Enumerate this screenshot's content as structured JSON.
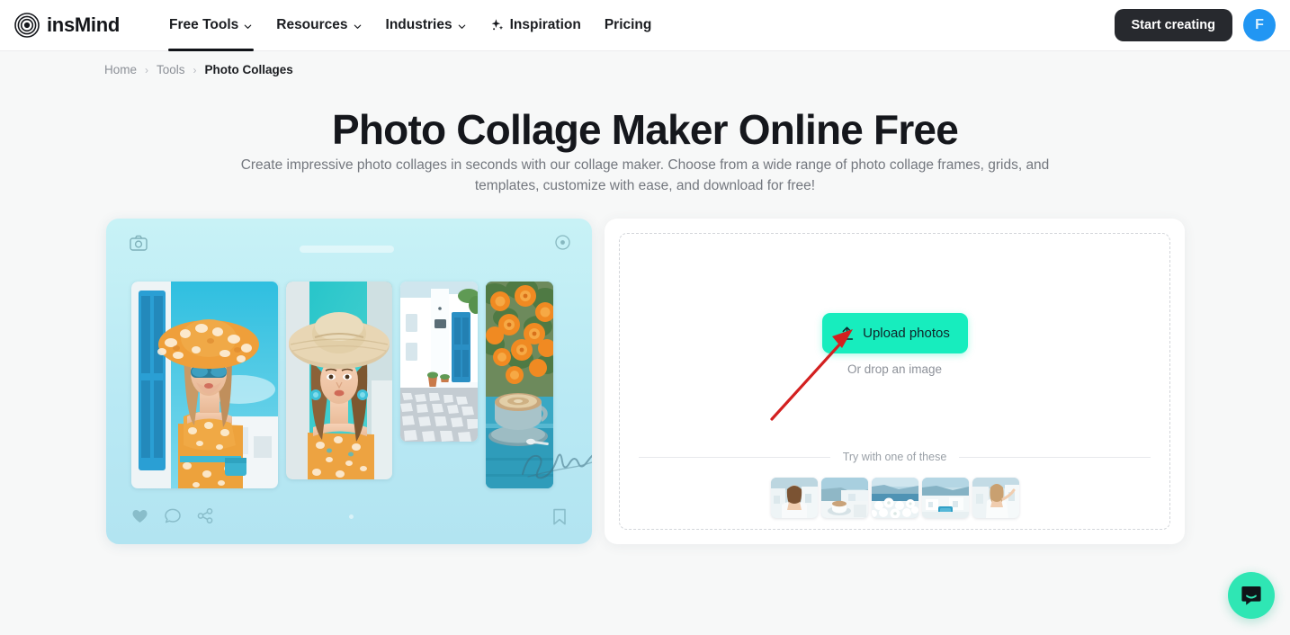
{
  "header": {
    "logo_text": "insMind",
    "logo_icon": "concentric-circles-logo",
    "nav": [
      {
        "label": "Free Tools",
        "has_caret": true,
        "active": true,
        "icon": "chevron-down-icon"
      },
      {
        "label": "Resources",
        "has_caret": true,
        "active": false,
        "icon": "chevron-down-icon"
      },
      {
        "label": "Industries",
        "has_caret": true,
        "active": false,
        "icon": "chevron-down-icon"
      },
      {
        "label": "Inspiration",
        "has_caret": false,
        "active": false,
        "icon": "sparkle-icon"
      },
      {
        "label": "Pricing",
        "has_caret": false,
        "active": false,
        "icon": ""
      }
    ],
    "start_creating_label": "Start creating",
    "avatar_initial": "F",
    "avatar_color": "#2196f3",
    "start_button_color": "#27292e"
  },
  "breadcrumb": {
    "home": "Home",
    "tools": "Tools",
    "current": "Photo Collages",
    "separator": "›"
  },
  "hero": {
    "title": "Photo Collage Maker Online Free",
    "subtitle": "Create impressive photo collages in seconds with our collage maker. Choose from a wide range of photo collage frames, grids, and templates, customize with ease, and download for free!"
  },
  "preview": {
    "card_bg": "#bce9f3",
    "camera_icon": "camera-icon",
    "circle_icon": "circle-plus-icon",
    "signature_text": "Santorini",
    "actions": [
      {
        "name": "heart-icon"
      },
      {
        "name": "comment-icon"
      },
      {
        "name": "share-icon"
      },
      {
        "name": "bookmark-icon"
      }
    ],
    "photos": [
      {
        "alt": "woman in orange floral dress with sun hat and sunglasses"
      },
      {
        "alt": "woman in wide brim straw hat with turquoise earrings"
      },
      {
        "alt": "white Santorini alley with blue door and cobblestones"
      },
      {
        "alt": "coffee cup with orange bougainvillea flowers"
      }
    ]
  },
  "upload": {
    "button_label": "Upload photos",
    "button_icon": "upload-arrow-icon",
    "button_color": "#17edbe",
    "drop_hint": "Or drop an image",
    "try_label": "Try with one of these",
    "dashed_border_color": "#d3d6da",
    "samples": [
      {
        "alt": "woman in white dress on Santorini terrace"
      },
      {
        "alt": "coffee cup overlooking Santorini caldera"
      },
      {
        "alt": "white flowers with blue sea view"
      },
      {
        "alt": "Santorini pool and white architecture"
      },
      {
        "alt": "woman in white dress against white wall"
      }
    ]
  },
  "annotation": {
    "arrow_color": "#d32020",
    "description": "red arrow pointing to upload photos button"
  },
  "chat": {
    "icon": "chat-bubble-icon",
    "bg_color": "#2fe6b4"
  }
}
